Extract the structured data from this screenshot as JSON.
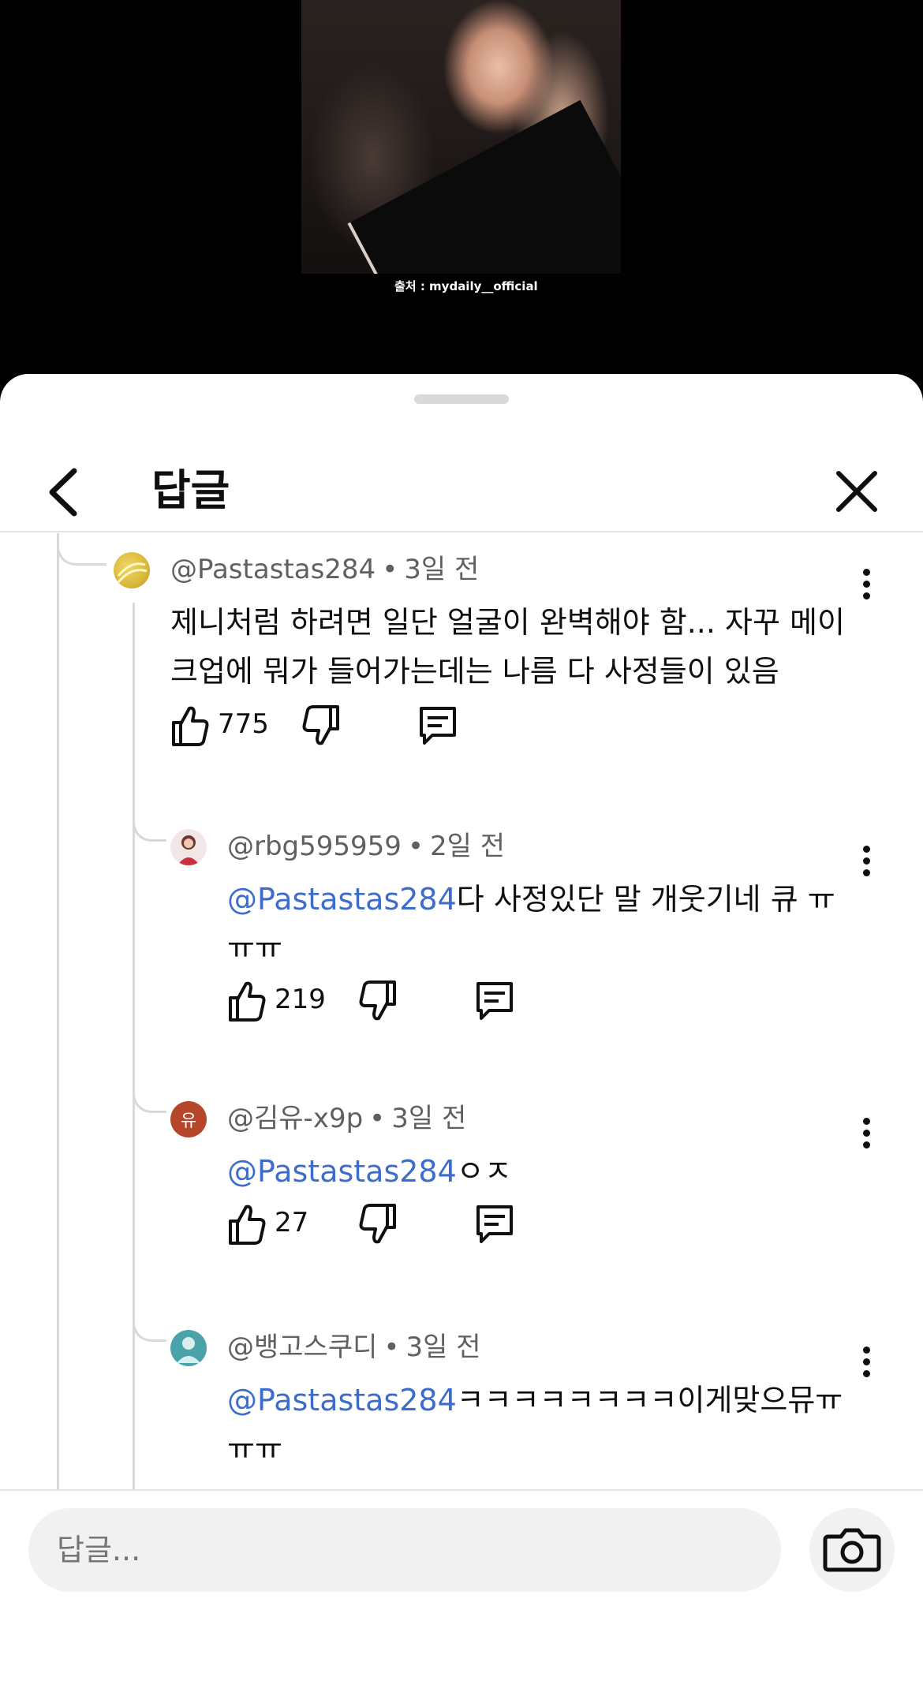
{
  "video": {
    "caption": "출처 : mydaily__official"
  },
  "header": {
    "title": "답글"
  },
  "comments": [
    {
      "handle": "@Pastastas284",
      "time": "3일 전",
      "text": "제니처럼 하려면 일단 얼굴이 완벽해야 함... 자꾸 메이크업에 뭐가 들어가는데는 나름 다 사정들이 있음",
      "likes": "775",
      "avatar_color": "#d9b83a"
    },
    {
      "handle": "@rbg595959",
      "time": "2일 전",
      "mention": "@Pastastas284",
      "text": "다 사정있단 말 개웃기네 큐 ㅠㅠㅠ",
      "likes": "219",
      "avatar_color": "#f3e6e6"
    },
    {
      "handle": "@김유-x9p",
      "time": "3일 전",
      "mention": "@Pastastas284",
      "text": "ㅇㅈ",
      "likes": "27",
      "avatar_letter": "유",
      "avatar_color": "#b5462a"
    },
    {
      "handle": "@뱅고스쿠디",
      "time": "3일 전",
      "mention": "@Pastastas284",
      "text": "ㅋㅋㅋㅋㅋㅋㅋㅋ이게맞으뮤ㅠㅠㅠ",
      "avatar_color": "#4aa3a8"
    }
  ],
  "composer": {
    "placeholder": "답글..."
  }
}
